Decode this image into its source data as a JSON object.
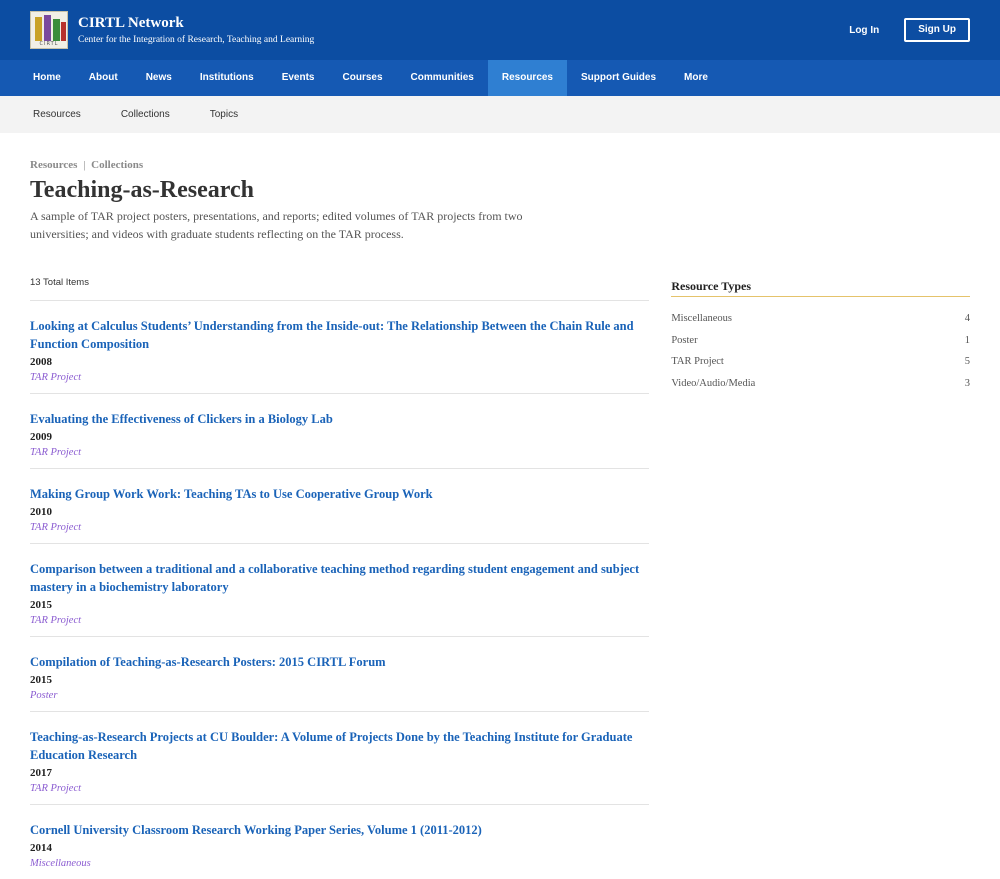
{
  "header": {
    "logo_text": "CIRTL",
    "title": "CIRTL Network",
    "subtitle": "Center for the Integration of Research, Teaching and Learning",
    "login_label": "Log In",
    "signup_label": "Sign Up"
  },
  "main_nav": {
    "items": [
      "Home",
      "About",
      "News",
      "Institutions",
      "Events",
      "Courses",
      "Communities",
      "Resources",
      "Support Guides",
      "More"
    ],
    "active": "Resources"
  },
  "sub_nav": {
    "items": [
      "Resources",
      "Collections",
      "Topics"
    ]
  },
  "page": {
    "breadcrumb": [
      "Resources",
      "Collections"
    ],
    "breadcrumb_sep": "|",
    "title": "Teaching-as-Research",
    "description": "A sample of TAR project posters, presentations, and reports; edited volumes of TAR projects from two universities; and videos with graduate students reflecting on the TAR process."
  },
  "results": {
    "total_label": "13 Total Items",
    "items": [
      {
        "title": "Looking at Calculus Students’ Understanding from the Inside-out: The Relationship Between the Chain Rule and Function Composition",
        "year": "2008",
        "type": "TAR Project"
      },
      {
        "title": "Evaluating the Effectiveness of Clickers in a Biology Lab",
        "year": "2009",
        "type": "TAR Project"
      },
      {
        "title": "Making Group Work Work: Teaching TAs to Use Cooperative Group Work",
        "year": "2010",
        "type": "TAR Project"
      },
      {
        "title": "Comparison between a traditional and a collaborative teaching method regarding student engagement and subject mastery in a biochemistry laboratory",
        "year": "2015",
        "type": "TAR Project"
      },
      {
        "title": "Compilation of Teaching-as-Research Posters: 2015 CIRTL Forum",
        "year": "2015",
        "type": "Poster"
      },
      {
        "title": "Teaching-as-Research Projects at CU Boulder: A Volume of Projects Done by the Teaching Institute for Graduate Education Research",
        "year": "2017",
        "type": "TAR Project"
      },
      {
        "title": "Cornell University Classroom Research Working Paper Series, Volume 1 (2011-2012)",
        "year": "2014",
        "type": "Miscellaneous"
      }
    ]
  },
  "sidebar": {
    "title": "Resource Types",
    "types": [
      {
        "label": "Miscellaneous",
        "count": "4"
      },
      {
        "label": "Poster",
        "count": "1"
      },
      {
        "label": "TAR Project",
        "count": "5"
      },
      {
        "label": "Video/Audio/Media",
        "count": "3"
      }
    ]
  }
}
